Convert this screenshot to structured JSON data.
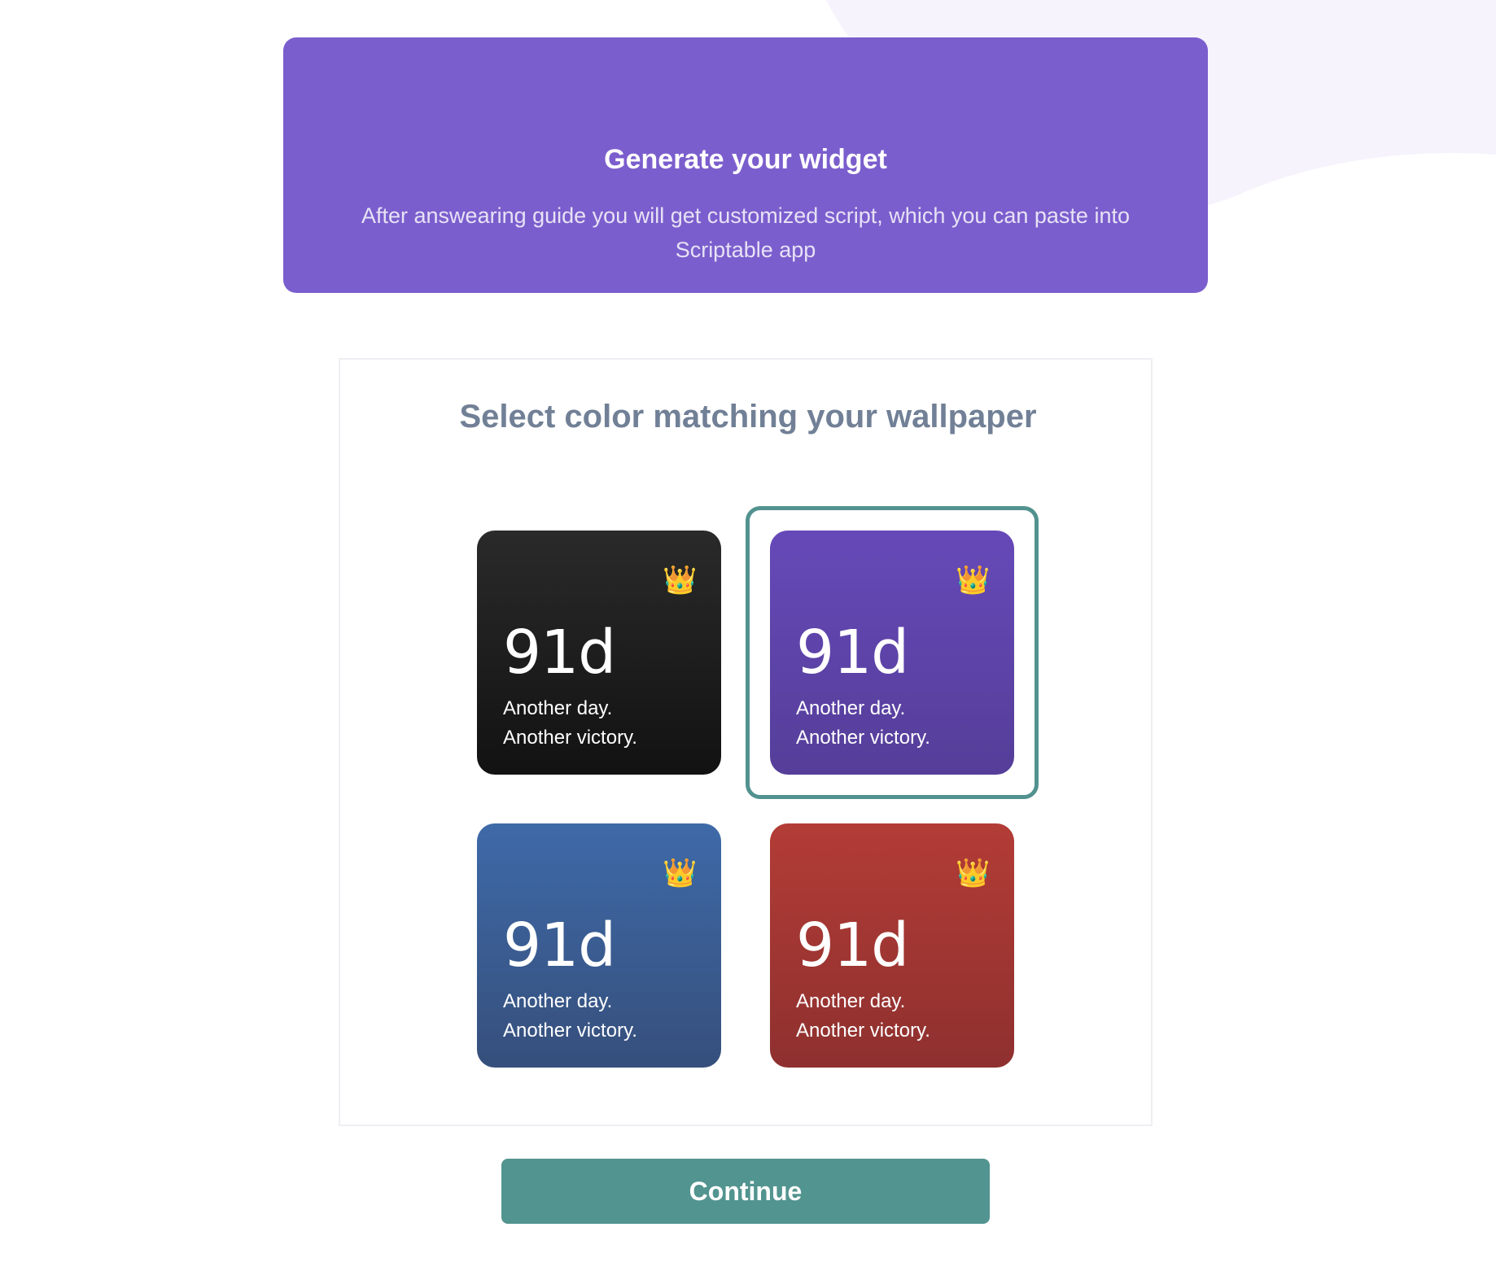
{
  "colors": {
    "hero_bg": "#7b5ecd",
    "heading_text": "#718096",
    "accent": "#52928f",
    "button_bg": "#52948f",
    "blob": "#f6f3fd"
  },
  "hero": {
    "title": "Generate your widget",
    "subtitle": "After answearing guide you will get customized script, which you can paste into Scriptable app"
  },
  "panel": {
    "heading": "Select color matching your wallpaper"
  },
  "widgets": [
    {
      "theme": "black",
      "gradient": [
        "#2a2a2a",
        "#121212"
      ],
      "selected": false,
      "icon": "crown-icon",
      "crown": "👑",
      "days": "91d",
      "line1": "Another day.",
      "line2": "Another victory."
    },
    {
      "theme": "purple",
      "gradient": [
        "#6649b8",
        "#553e99"
      ],
      "selected": true,
      "icon": "crown-icon",
      "crown": "👑",
      "days": "91d",
      "line1": "Another day.",
      "line2": "Another victory."
    },
    {
      "theme": "blue",
      "gradient": [
        "#3e6aa8",
        "#364f7c"
      ],
      "selected": false,
      "icon": "crown-icon",
      "crown": "👑",
      "days": "91d",
      "line1": "Another day.",
      "line2": "Another victory."
    },
    {
      "theme": "red",
      "gradient": [
        "#b33c36",
        "#8e302f"
      ],
      "selected": false,
      "icon": "crown-icon",
      "crown": "👑",
      "days": "91d",
      "line1": "Another day.",
      "line2": "Another victory."
    }
  ],
  "continue_label": "Continue"
}
